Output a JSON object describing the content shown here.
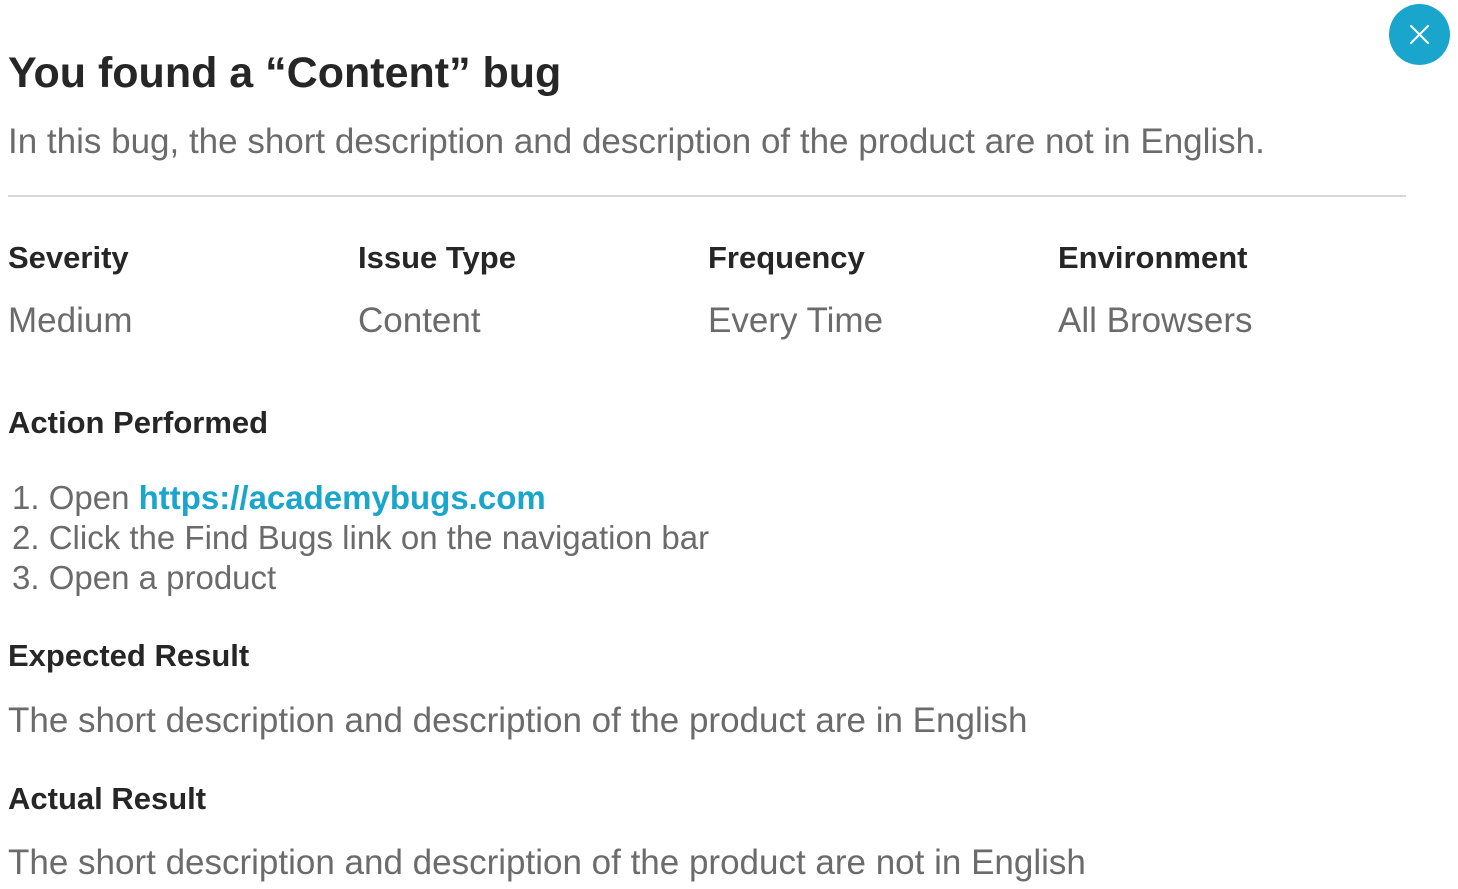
{
  "modal": {
    "title": "You found a “Content” bug",
    "subtitle": "In this bug, the short description and description of the product are not in English.",
    "accent_color": "#1aa5cd"
  },
  "close_icon": "close-icon",
  "meta": {
    "severity": {
      "label": "Severity",
      "value": "Medium"
    },
    "issue_type": {
      "label": "Issue Type",
      "value": "Content"
    },
    "frequency": {
      "label": "Frequency",
      "value": "Every Time"
    },
    "environment": {
      "label": "Environment",
      "value": "All Browsers"
    }
  },
  "action_performed": {
    "heading": "Action Performed",
    "steps": [
      {
        "number": "1.",
        "text": "Open",
        "link": "https://academybugs.com"
      },
      {
        "number": "2.",
        "text": "Click the Find Bugs link on the navigation bar"
      },
      {
        "number": "3.",
        "text": "Open a product"
      }
    ]
  },
  "expected_result": {
    "heading": "Expected Result",
    "text": "The short description and description of the product are in English"
  },
  "actual_result": {
    "heading": "Actual Result",
    "text": "The short description and description of the product are not in English"
  }
}
